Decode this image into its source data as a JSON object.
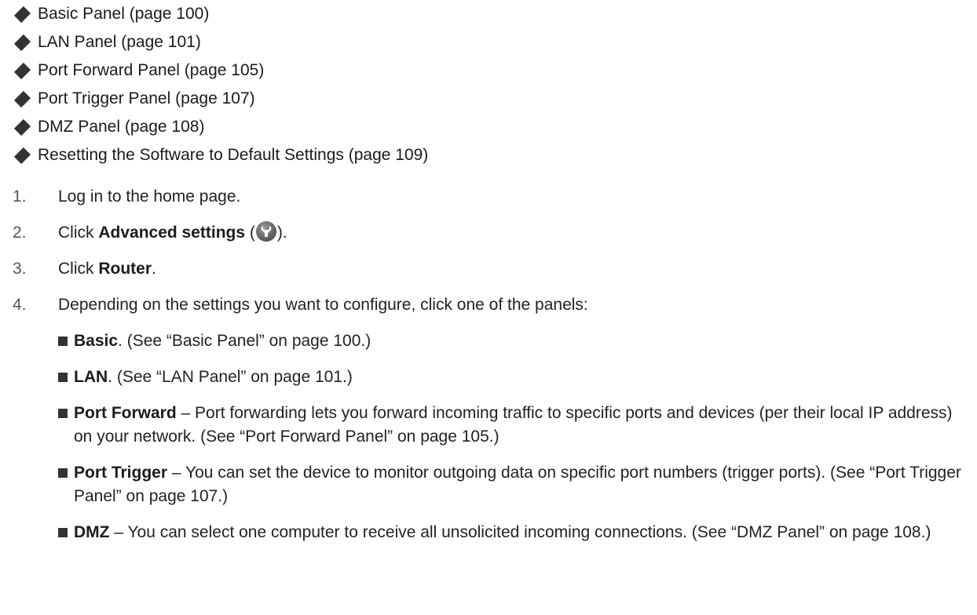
{
  "links": [
    {
      "label": "Basic Panel (page 100)"
    },
    {
      "label": "LAN Panel (page 101)"
    },
    {
      "label": "Port Forward Panel (page 105)"
    },
    {
      "label": "Port Trigger Panel (page 107)"
    },
    {
      "label": "DMZ Panel (page 108)"
    },
    {
      "label": "Resetting the Software to Default Settings (page 109)"
    }
  ],
  "steps": [
    {
      "num": "1.",
      "text": "Log in to the home page."
    },
    {
      "num": "2.",
      "prefix": "Click ",
      "bold": "Advanced settings",
      "open": " (",
      "icon": "wrench-icon",
      "close": ")."
    },
    {
      "num": "3.",
      "prefix": "Click ",
      "bold": "Router",
      "suffix": "."
    },
    {
      "num": "4.",
      "text": "Depending on the settings you want to configure, click one of the panels:"
    }
  ],
  "subitems": [
    {
      "bold": "Basic",
      "text": ". (See “Basic Panel” on page 100.)"
    },
    {
      "bold": "LAN",
      "text": ". (See “LAN Panel” on page 101.)"
    },
    {
      "bold": "Port Forward",
      "text": " – Port forwarding lets you forward incoming traffic to specific ports and devices (per their local IP address) on your network. (See “Port Forward Panel” on page 105.)"
    },
    {
      "bold": "Port Trigger",
      "text": " – You can set the device to monitor outgoing data on specific port numbers (trigger ports). (See “Port Trigger Panel” on page 107.)"
    },
    {
      "bold": "DMZ",
      "text": " – You can select one computer to receive all unsolicited incoming connections. (See “DMZ Panel” on page 108.)"
    }
  ]
}
